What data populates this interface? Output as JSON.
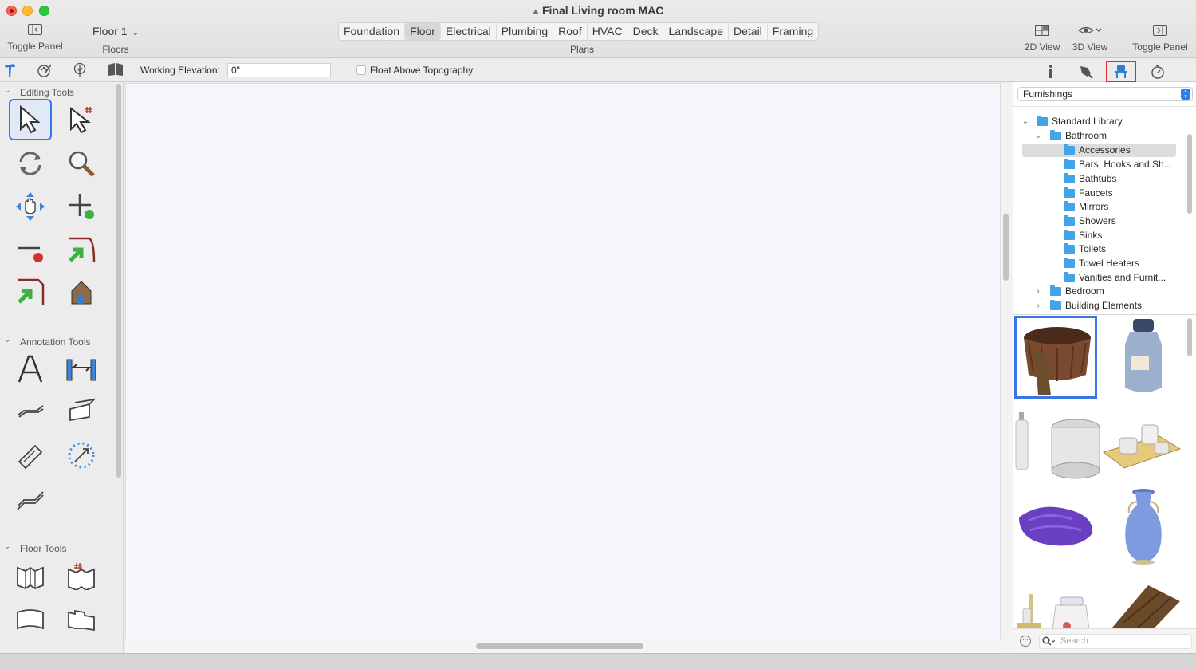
{
  "window": {
    "title": "Final Living room MAC"
  },
  "toolbar": {
    "toggle_panel_left": "Toggle Panel",
    "floor_value": "Floor 1",
    "floors_label": "Floors",
    "plans_label": "Plans",
    "plans": [
      "Foundation",
      "Floor",
      "Electrical",
      "Plumbing",
      "Roof",
      "HVAC",
      "Deck",
      "Landscape",
      "Detail",
      "Framing"
    ],
    "active_plan": "Floor",
    "view_2d": "2D View",
    "view_3d": "3D View",
    "toggle_panel_right": "Toggle Panel"
  },
  "subbar": {
    "working_elevation_label": "Working Elevation:",
    "working_elevation_value": "0\"",
    "float_label": "Float Above Topography",
    "float_checked": false
  },
  "left_panel": {
    "sections": {
      "editing": "Editing Tools",
      "annotation": "Annotation Tools",
      "floor": "Floor Tools"
    }
  },
  "library": {
    "category": "Furnishings",
    "tree": [
      {
        "label": "Standard Library",
        "level": 0,
        "expanded": true
      },
      {
        "label": "Bathroom",
        "level": 1,
        "expanded": true
      },
      {
        "label": "Accessories",
        "level": 2,
        "selected": true
      },
      {
        "label": "Bars, Hooks and Sh...",
        "level": 2
      },
      {
        "label": "Bathtubs",
        "level": 2
      },
      {
        "label": "Faucets",
        "level": 2
      },
      {
        "label": "Mirrors",
        "level": 2
      },
      {
        "label": "Showers",
        "level": 2
      },
      {
        "label": "Sinks",
        "level": 2
      },
      {
        "label": "Toilets",
        "level": 2
      },
      {
        "label": "Towel Heaters",
        "level": 2
      },
      {
        "label": "Vanities and Furnit...",
        "level": 2
      },
      {
        "label": "Bedroom",
        "level": 1,
        "expanded": false
      },
      {
        "label": "Building Elements",
        "level": 1,
        "expanded": false
      }
    ],
    "search_placeholder": "Search"
  },
  "colors": {
    "accent": "#3478f6",
    "folder": "#41a5e6",
    "highlight_box": "#e02b2b"
  }
}
